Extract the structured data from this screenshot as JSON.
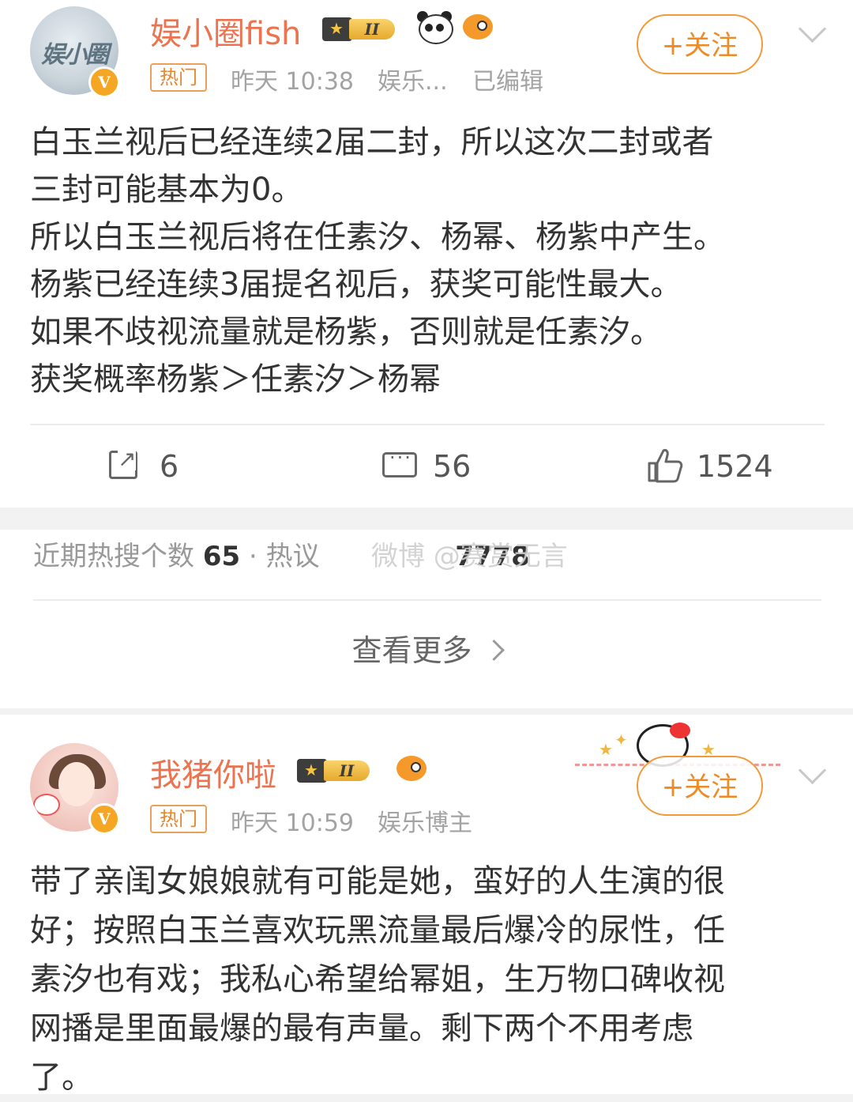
{
  "post1": {
    "avatar_text": "娱小圈",
    "verified_mark": "V",
    "username": "娱小圈fish",
    "level": "II",
    "hot_tag": "热门",
    "time": "昨天 10:38",
    "source": "娱乐...",
    "edited": "已编辑",
    "follow_label": "+关注",
    "lines": [
      "白玉兰视后已经连续2届二封，所以这次二封或者",
      "三封可能基本为0。",
      "所以白玉兰视后将在任素汐、杨幂、杨紫中产生。",
      "杨紫已经连续3届提名视后，获奖可能性最大。",
      "如果不歧视流量就是杨紫，否则就是任素汐。",
      "获奖概率杨紫＞任素汐＞杨幂"
    ],
    "reposts": "6",
    "comments": "56",
    "likes": "1524"
  },
  "hot_panel": {
    "label1": "近期热搜个数",
    "value1": "65",
    "sep": "·",
    "label2": "热议",
    "value2": "7778",
    "watermark": "微博 @赛赏无言",
    "more_label": "查看更多"
  },
  "post2": {
    "verified_mark": "V",
    "username": "我猪你啦",
    "level": "II",
    "hot_tag": "热门",
    "time": "昨天 10:59",
    "source": "娱乐博主",
    "follow_label": "+关注",
    "lines": [
      "带了亲闺女娘娘就有可能是她，蛮好的人生演的很",
      "好；按照白玉兰喜欢玩黑流量最后爆冷的尿性，任",
      "素汐也有戏；我私心希望给幂姐，生万物口碑收视",
      "网播是里面最爆的最有声量。剩下两个不用考虑",
      "了。"
    ]
  },
  "colors": {
    "username": "#eb7350",
    "accent": "#f29a3a",
    "hot_tag": "#e9852b",
    "meta": "#a3a3a3"
  }
}
